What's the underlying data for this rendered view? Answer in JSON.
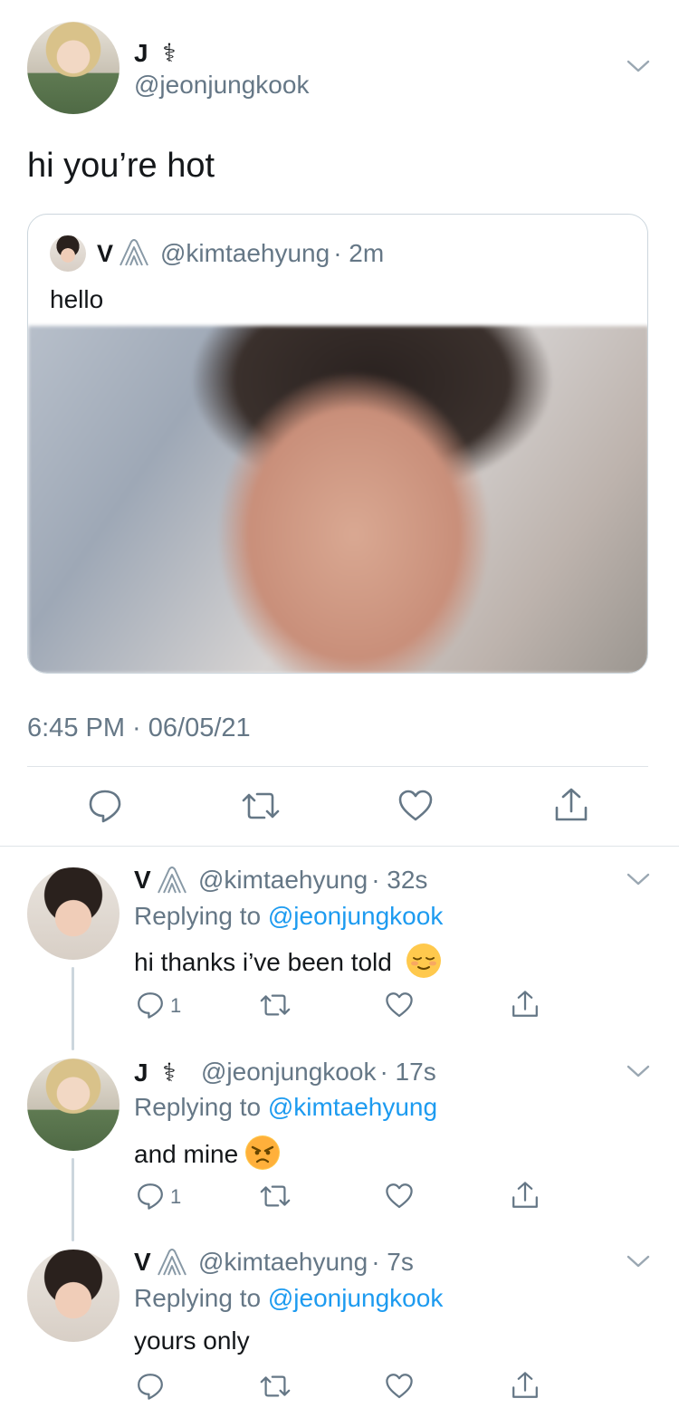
{
  "main_tweet": {
    "name": "J",
    "name_symbol": "⚕",
    "handle": "@jeonjungkook",
    "text": "hi you’re hot",
    "timestamp": "6:45 PM · 06/05/21"
  },
  "quoted_tweet": {
    "name": "V",
    "handle": "@kimtaehyung",
    "time": "· 2m",
    "text": "hello"
  },
  "replies": [
    {
      "name": "V",
      "handle": "@kimtaehyung",
      "time": "· 32s",
      "replying_prefix": "Replying to ",
      "replying_to": "@jeonjungkook",
      "text": "hi thanks i’ve been told",
      "reply_count": "1",
      "emoji": "relieved-face"
    },
    {
      "name": "J",
      "name_symbol": "⚕",
      "handle": "@jeonjungkook",
      "time": "· 17s",
      "replying_prefix": "Replying to ",
      "replying_to": "@kimtaehyung",
      "text": "and mine",
      "reply_count": "1",
      "emoji": "angry-face"
    },
    {
      "name": "V",
      "handle": "@kimtaehyung",
      "time": "· 7s",
      "replying_prefix": "Replying to ",
      "replying_to": "@jeonjungkook",
      "text": "yours only",
      "reply_count": ""
    }
  ],
  "colors": {
    "text": "#14171a",
    "secondary": "#657786",
    "link": "#1d9bf0",
    "divider": "#dfe4e8"
  }
}
